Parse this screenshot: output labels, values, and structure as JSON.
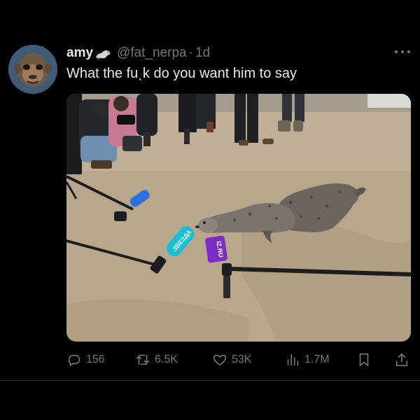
{
  "tweet": {
    "display_name": "amy",
    "handle": "@fat_nerpa",
    "separator": "·",
    "time": "1d",
    "text": "What the fuˎk do you want him to say",
    "name_emoji_icon": "seal-emoji-icon",
    "media": {
      "microphones": [
        {
          "label": "",
          "color": "#2b6fe0"
        },
        {
          "label": "ЗВЕЗДА",
          "color": "#19c0d2"
        },
        {
          "label": "IZ.RU",
          "color": "#7a2cc5"
        }
      ]
    }
  },
  "actions": {
    "reply_count": "156",
    "retweet_count": "6.5K",
    "like_count": "53K",
    "views_count": "1.7M"
  },
  "colors": {
    "background": "#000000",
    "text_primary": "#e7e9ea",
    "text_secondary": "#71767b"
  }
}
